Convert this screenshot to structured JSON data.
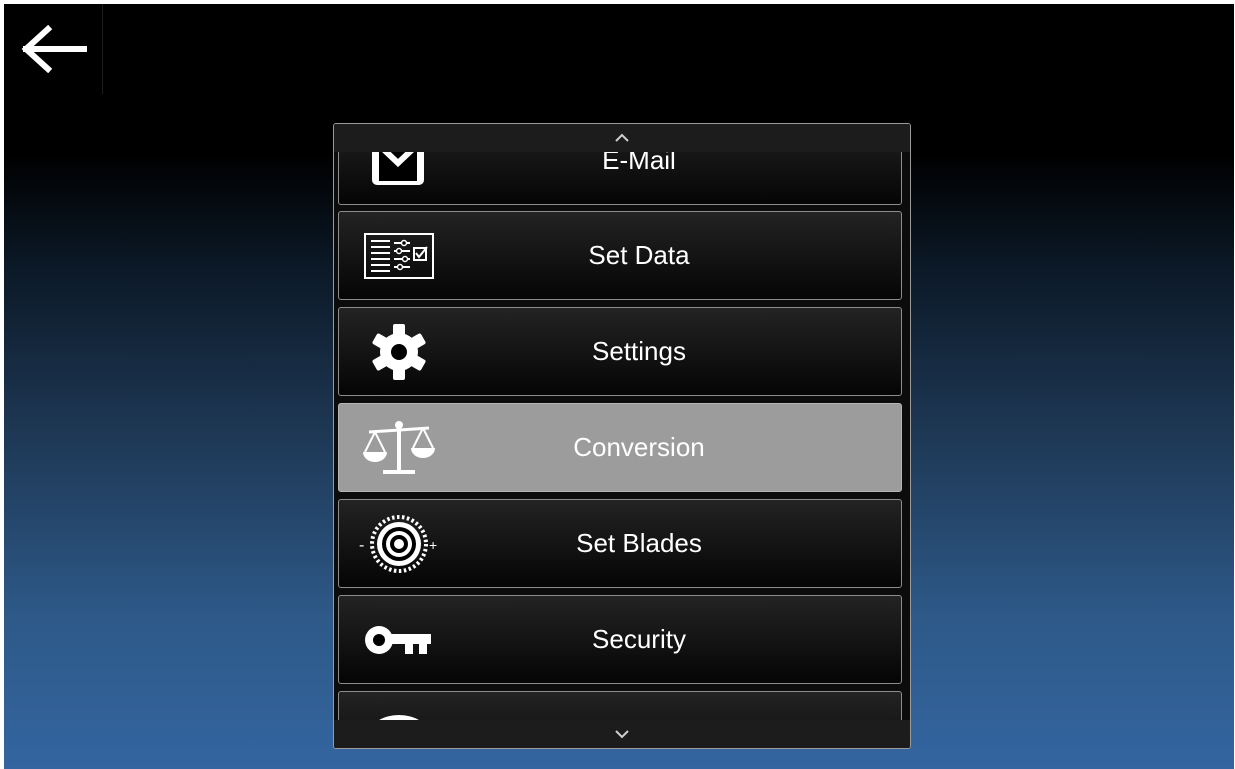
{
  "header": {
    "back_icon": "arrow-left-icon"
  },
  "menu": {
    "scroll_up_icon": "chevron-up-icon",
    "scroll_down_icon": "chevron-down-icon",
    "selected_bg": "#9c9c9c",
    "items": [
      {
        "label": "E-Mail",
        "icon": "mail-icon"
      },
      {
        "label": "Set Data",
        "icon": "data-settings-icon"
      },
      {
        "label": "Settings",
        "icon": "gear-icon"
      },
      {
        "label": "Conversion",
        "icon": "scales-icon",
        "selected": true
      },
      {
        "label": "Set Blades",
        "icon": "saw-blade-icon"
      },
      {
        "label": "Security",
        "icon": "key-icon"
      },
      {
        "label": "",
        "icon": "round-icon"
      }
    ]
  }
}
